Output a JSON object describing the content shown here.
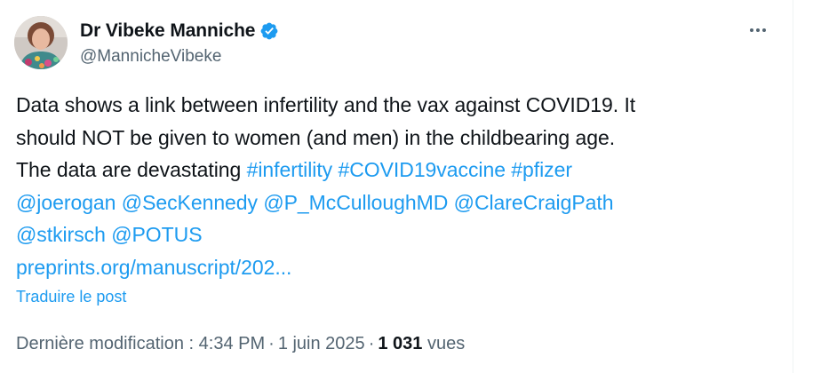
{
  "author": {
    "display_name": "Dr Vibeke Manniche",
    "handle": "@MannicheVibeke",
    "verified_icon": "verified-badge-icon",
    "avatar_alt": "profile photo"
  },
  "post": {
    "line1": "Data shows a link between infertility and the vax against COVID19. It",
    "line2": "should NOT be given to women (and men) in the childbearing age.",
    "line3_text": "The data are devastating ",
    "hashtags": [
      "#infertility",
      "#COVID19vaccine",
      "#pfizer"
    ],
    "mentions_line4": [
      "@joerogan",
      "@SecKennedy",
      "@P_McCulloughMD",
      "@ClareCraigPath"
    ],
    "mentions_line5": [
      "@stkirsch",
      "@POTUS"
    ],
    "link": "preprints.org/manuscript/202..."
  },
  "translate_label": "Traduire le post",
  "meta": {
    "modified_label": "Dernière modification : ",
    "time": "4:34 PM",
    "separator": "·",
    "date": "1 juin 2025",
    "views_count": "1 031",
    "views_label": " vues"
  },
  "colors": {
    "link": "#1d9bf0",
    "text": "#0f1419",
    "secondary": "#536471",
    "verified": "#1d9bf0"
  }
}
